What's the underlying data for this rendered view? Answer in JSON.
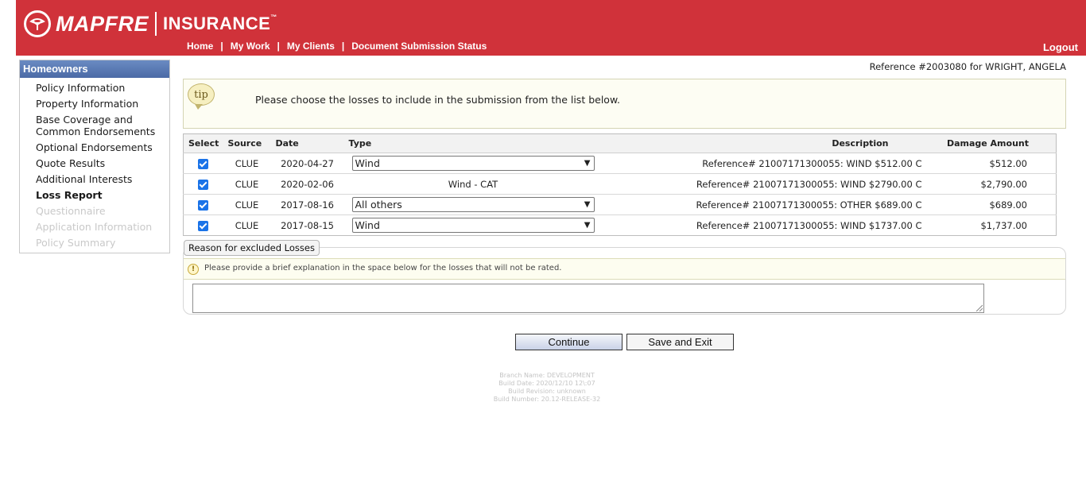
{
  "header": {
    "brand": "MAPFRE",
    "product": "INSURANCE",
    "trademark": "™",
    "nav": [
      "Home",
      "My Work",
      "My Clients",
      "Document Submission Status"
    ],
    "separator": "|",
    "logout": "Logout",
    "brand_color": "#d0323a"
  },
  "sidebar": {
    "title": "Homeowners",
    "items": [
      {
        "label": "Policy Information",
        "state": "enabled"
      },
      {
        "label": "Property Information",
        "state": "enabled"
      },
      {
        "label": "Base Coverage and Common Endorsements",
        "state": "enabled"
      },
      {
        "label": "Optional Endorsements",
        "state": "enabled"
      },
      {
        "label": "Quote Results",
        "state": "enabled"
      },
      {
        "label": "Additional Interests",
        "state": "enabled"
      },
      {
        "label": "Loss Report",
        "state": "active"
      },
      {
        "label": "Questionnaire",
        "state": "disabled"
      },
      {
        "label": "Application Information",
        "state": "disabled"
      },
      {
        "label": "Policy Summary",
        "state": "disabled"
      }
    ]
  },
  "reference": "Reference #2003080 for WRIGHT, ANGELA",
  "tip": {
    "icon_label": "tip",
    "text": "Please choose the losses to include in the submission from the list below."
  },
  "losses_table": {
    "headers": {
      "select": "Select",
      "source": "Source",
      "date": "Date",
      "type": "Type",
      "description": "Description",
      "amount": "Damage Amount"
    },
    "rows": [
      {
        "checked": true,
        "source": "CLUE",
        "date": "2020-04-27",
        "type": "Wind",
        "type_is_select": true,
        "description": "Reference# 21007171300055: WIND $512.00 C",
        "amount": "$512.00"
      },
      {
        "checked": true,
        "source": "CLUE",
        "date": "2020-02-06",
        "type": "Wind - CAT",
        "type_is_select": false,
        "description": "Reference# 21007171300055: WIND $2790.00 C",
        "amount": "$2,790.00"
      },
      {
        "checked": true,
        "source": "CLUE",
        "date": "2017-08-16",
        "type": "All others",
        "type_is_select": true,
        "description": "Reference# 21007171300055: OTHER $689.00 C",
        "amount": "$689.00"
      },
      {
        "checked": true,
        "source": "CLUE",
        "date": "2017-08-15",
        "type": "Wind",
        "type_is_select": true,
        "description": "Reference# 21007171300055: WIND $1737.00 C",
        "amount": "$1,737.00"
      }
    ]
  },
  "reason": {
    "tab_label": "Reason for excluded Losses",
    "note_icon": "!",
    "note": "Please provide a brief explanation in the space below for the losses that will not be rated.",
    "text_value": ""
  },
  "buttons": {
    "continue": "Continue",
    "save_exit": "Save and Exit"
  },
  "build_info": {
    "branch": "Branch Name: DEVELOPMENT",
    "date": "Build Date: 2020/12/10 12\\:07",
    "revision": "Build Revision: unknown",
    "number": "Build Number: 20.12-RELEASE-32"
  }
}
